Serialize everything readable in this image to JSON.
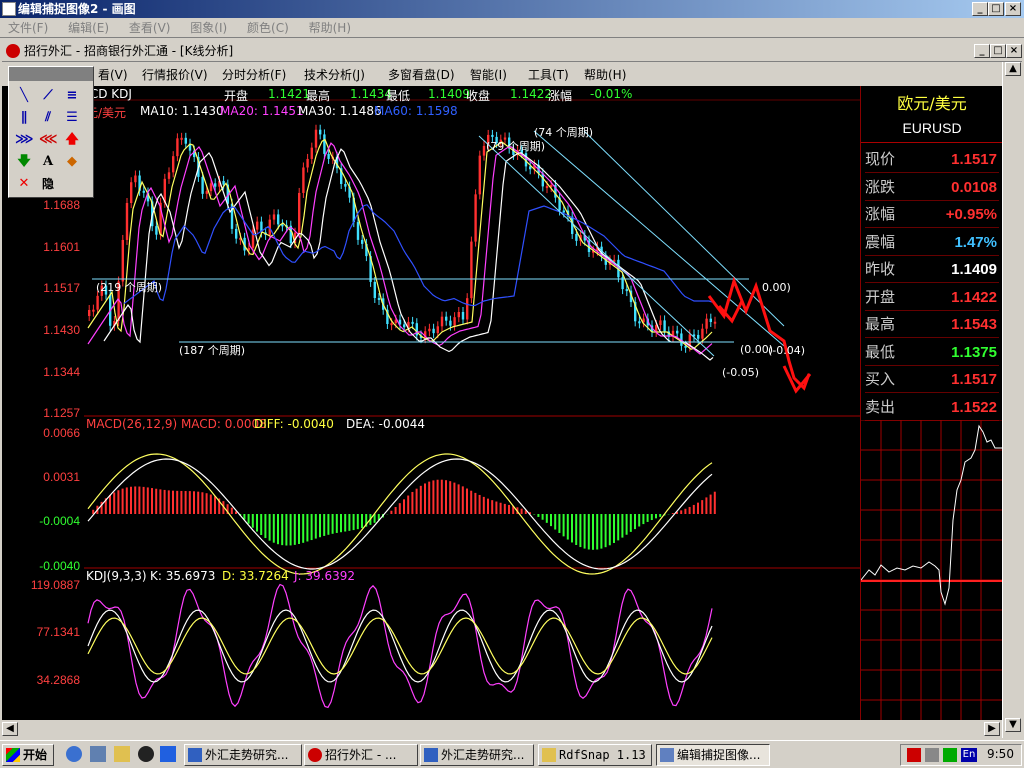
{
  "window": {
    "title": "编辑捕捉图像2 - 画图"
  },
  "menu": [
    "文件(F)",
    "编辑(E)",
    "查看(V)",
    "图象(I)",
    "颜色(C)",
    "帮助(H)"
  ],
  "inner_window": {
    "title": "招行外汇 - 招商银行外汇通 - [K线分析]"
  },
  "inner_menu": [
    "看(V)",
    "行情报价(V)",
    "分时分析(F)",
    "技术分析(J)",
    "多窗看盘(D)",
    "智能(I)",
    "工具(T)",
    "帮助(H)"
  ],
  "quote_bar": {
    "prefix": ".CD KDJ",
    "open_label": "开盘",
    "open": "1.1421",
    "high_label": "最高",
    "high": "1.1434",
    "low_label": "最低",
    "low": "1.1409",
    "close_label": "收盘",
    "close": "1.1422",
    "change_label": "涨幅",
    "change": "-0.01%"
  },
  "ma_line": {
    "name": "元/美元",
    "ma10": "MA10: 1.1430",
    "ma20": "MA20: 1.1451",
    "ma30": "MA30: 1.1486",
    "ma60": "MA60: 1.1598"
  },
  "price_axis": [
    "1.1688",
    "1.1601",
    "1.1517",
    "1.1430",
    "1.1344",
    "1.1257"
  ],
  "macd": {
    "title": "MACD(26,12,9) MACD: 0.0008",
    "diff": "DIFF: -0.0040",
    "dea": "DEA: -0.0044",
    "axis": [
      "0.0066",
      "0.0031",
      "-0.0004",
      "-0.0040"
    ]
  },
  "kdj": {
    "title": "KDJ(9,3,3)",
    "k": "K: 35.6973",
    "d": "D: 33.7264",
    "j": "J: 39.6392",
    "axis": [
      "119.0887",
      "77.1341",
      "34.2868"
    ]
  },
  "annotations": [
    "(74 个周期)",
    "(79 个周期)",
    "(219 个周期)",
    "(187 个周期)",
    "0.00)",
    "(0.00)",
    "(-0.04)",
    "(-0.05)"
  ],
  "right_panel": {
    "name": "欧元/美元",
    "code": "EURUSD",
    "rows": [
      {
        "k": "现价",
        "v": "1.1517",
        "color": "#ff3030"
      },
      {
        "k": "涨跌",
        "v": "0.0108",
        "color": "#ff3030"
      },
      {
        "k": "涨幅",
        "v": "+0.95%",
        "color": "#ff3030"
      },
      {
        "k": "震幅",
        "v": "1.47%",
        "color": "#40c0ff"
      },
      {
        "k": "昨收",
        "v": "1.1409",
        "color": "#ffffff"
      },
      {
        "k": "开盘",
        "v": "1.1422",
        "color": "#ff3030"
      },
      {
        "k": "最高",
        "v": "1.1543",
        "color": "#ff3030"
      },
      {
        "k": "最低",
        "v": "1.1375",
        "color": "#30ff30"
      },
      {
        "k": "买入",
        "v": "1.1517",
        "color": "#ff3030"
      },
      {
        "k": "卖出",
        "v": "1.1522",
        "color": "#ff3030"
      }
    ]
  },
  "taskbar": {
    "start": "开始",
    "tasks": [
      "外汇走势研究...",
      "招行外汇 - ...",
      "外汇走势研究...",
      "RdfSnap 1.13",
      "编辑捕捉图像..."
    ],
    "clock": "9:50",
    "lang": "En"
  }
}
